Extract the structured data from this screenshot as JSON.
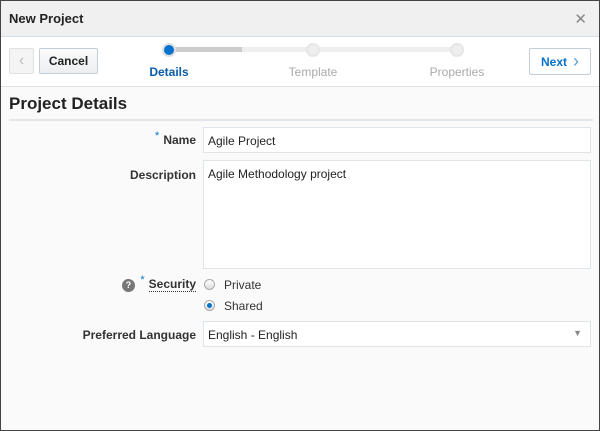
{
  "dialog": {
    "title": "New Project",
    "close_icon": "close-icon"
  },
  "toolbar": {
    "cancel_label": "Cancel",
    "next_label": "Next"
  },
  "train": {
    "steps": [
      {
        "label": "Details",
        "active": true
      },
      {
        "label": "Template",
        "active": false
      },
      {
        "label": "Properties",
        "active": false
      }
    ]
  },
  "section": {
    "title": "Project Details"
  },
  "form": {
    "name": {
      "label": "Name",
      "required": "*",
      "value": "Agile Project"
    },
    "description": {
      "label": "Description",
      "value": "Agile Methodology project"
    },
    "security": {
      "label": "Security",
      "required": "*",
      "help": "?",
      "options": [
        "Private",
        "Shared"
      ],
      "selected": "Shared"
    },
    "language": {
      "label": "Preferred Language",
      "value": "English - English"
    }
  },
  "colors": {
    "accent": "#0572ce"
  }
}
